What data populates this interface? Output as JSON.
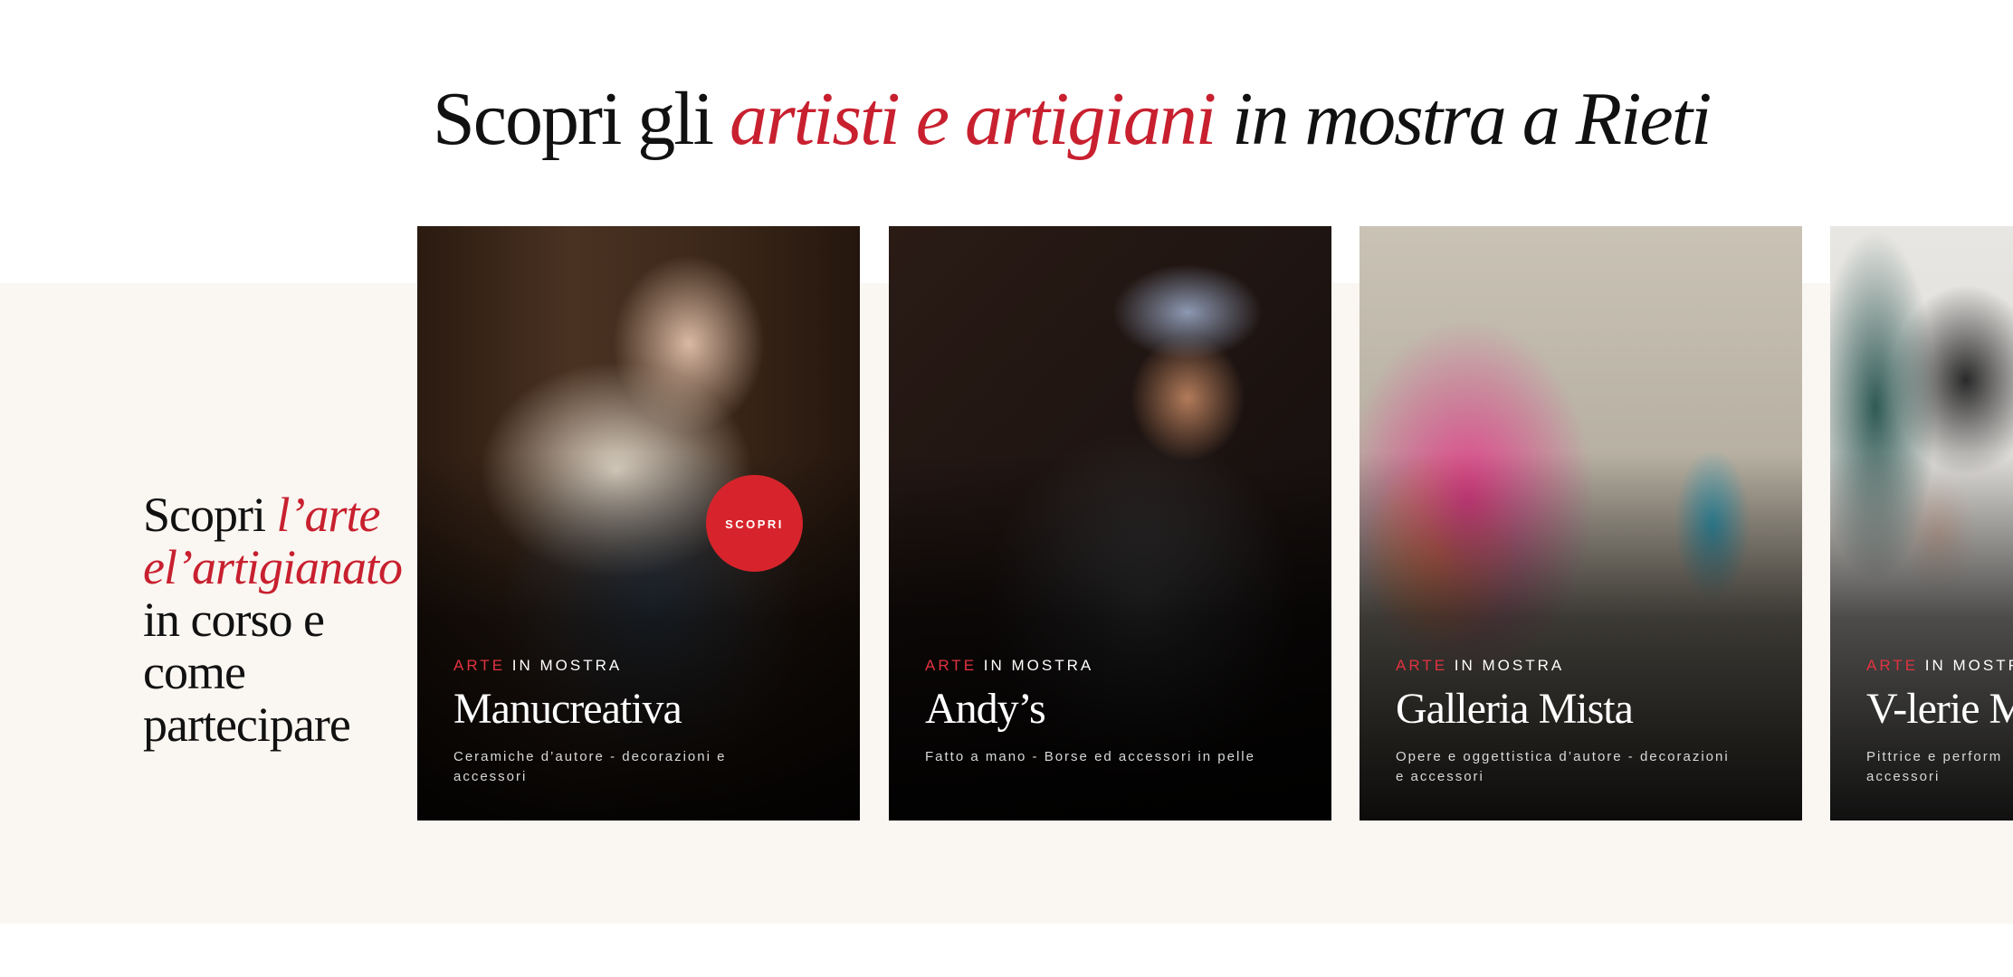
{
  "headline": {
    "part1": "Scopri gli ",
    "highlight": "artisti e artigiani",
    "part2": " in mostra a Rieti"
  },
  "side_title": {
    "line1_plain": "Scopri ",
    "line1_highlight": "l’arte",
    "line2_highlight": "el’artigianato",
    "line3": "in corso e",
    "line4": "come",
    "line5": "partecipare"
  },
  "scopri_button": "SCOPRI",
  "cards": [
    {
      "kicker_red": "ARTE",
      "kicker_rest": " IN MOSTRA",
      "name": "Manucreativa",
      "description": "Ceramiche d’autore - decorazioni e accessori"
    },
    {
      "kicker_red": "ARTE",
      "kicker_rest": " IN MOSTRA",
      "name": "Andy’s",
      "description": "Fatto a mano - Borse ed accessori in pelle"
    },
    {
      "kicker_red": "ARTE",
      "kicker_rest": " IN MOSTRA",
      "name": "Galleria Mista",
      "description": "Opere e oggettistica d’autore - decorazioni e accessori"
    },
    {
      "kicker_red": "ARTE",
      "kicker_rest": " IN MOSTRA",
      "name": "V-lerie M",
      "description": "Pittrice e perform accessori"
    }
  ],
  "colors": {
    "accent_red": "#c8202f",
    "band_background": "#faf6f1"
  }
}
